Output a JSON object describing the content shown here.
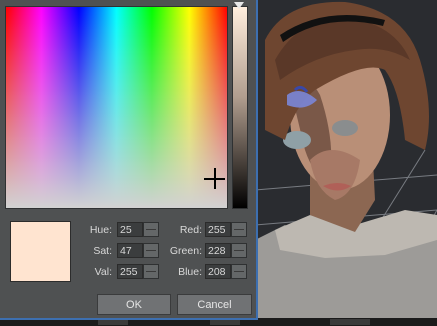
{
  "dialog": {
    "hue_label": "Hue:",
    "hue_value": "25",
    "sat_label": "Sat:",
    "sat_value": "47",
    "val_label": "Val:",
    "val_value": "255",
    "red_label": "Red:",
    "red_value": "255",
    "green_label": "Green:",
    "green_value": "228",
    "blue_label": "Blue:",
    "blue_value": "208",
    "ok_label": "OK",
    "cancel_label": "Cancel",
    "selected_color": "#ffe4d0",
    "dialog_border_color": "#3d6fb0"
  },
  "icons": {
    "crosshair": "crosshair-icon",
    "slider_marker": "triangle-down-icon",
    "stepper": "stepper-icon"
  }
}
